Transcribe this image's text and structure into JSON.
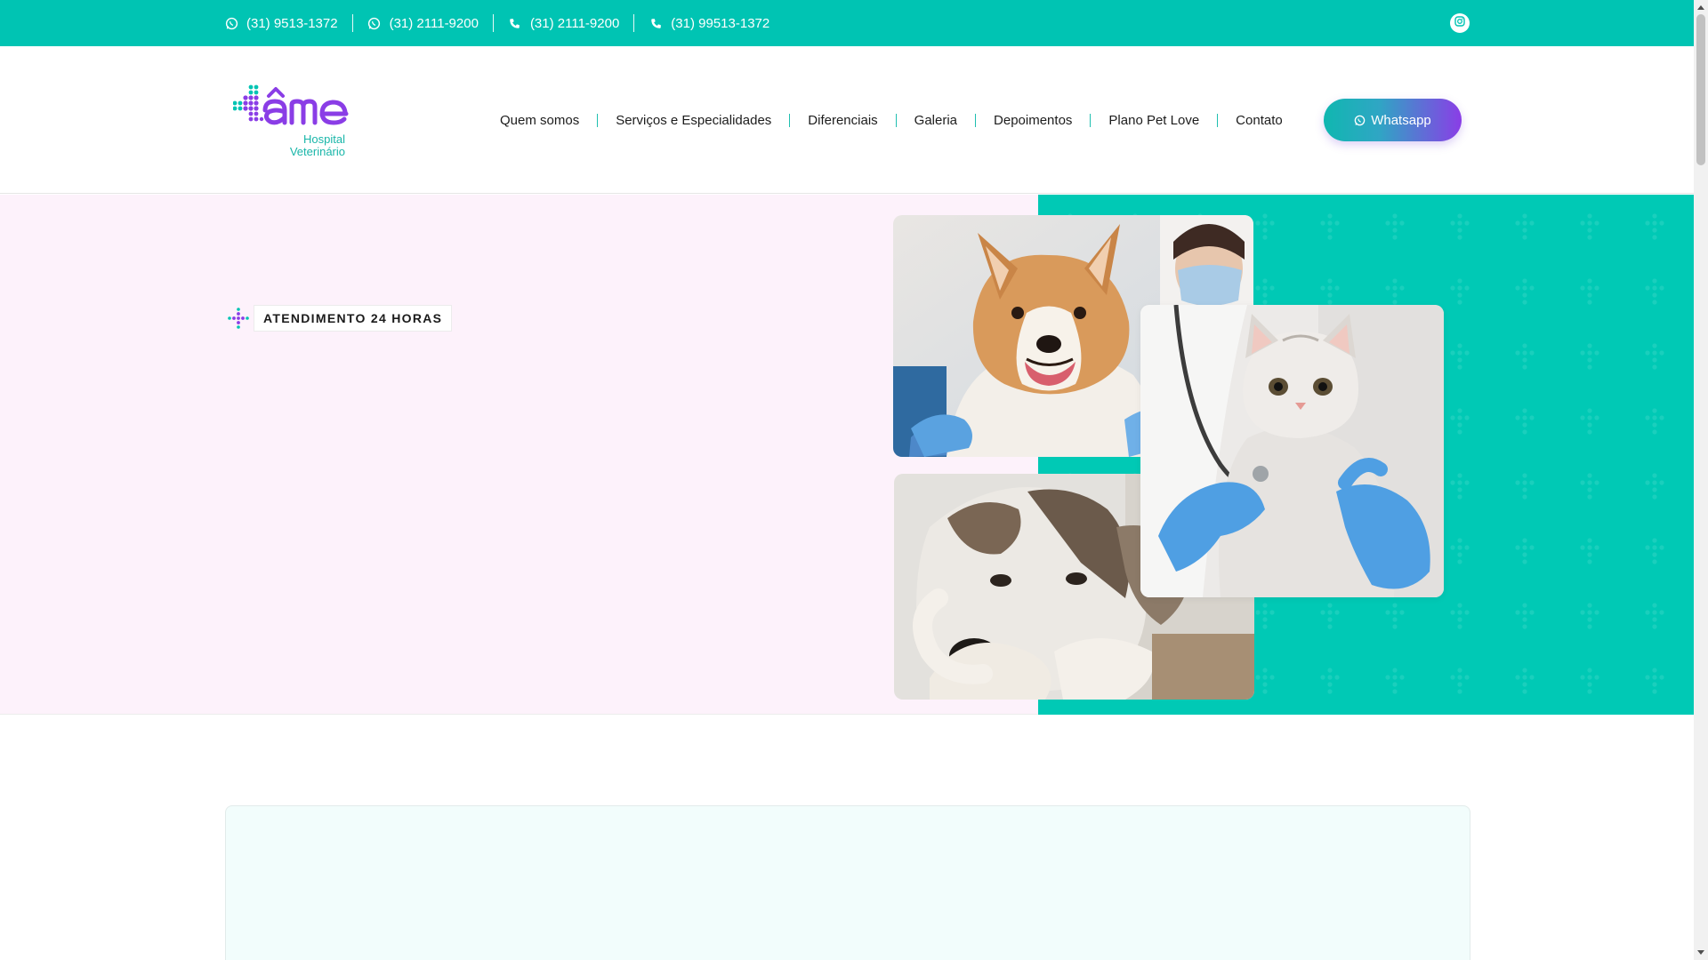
{
  "topbar": {
    "contacts": [
      {
        "icon": "whatsapp-icon",
        "text": "(31) 9513-1372"
      },
      {
        "icon": "whatsapp-icon",
        "text": "(31) 2111-9200"
      },
      {
        "icon": "phone-icon",
        "text": "(31) 2111-9200"
      },
      {
        "icon": "phone-icon",
        "text": "(31) 99513-1372"
      }
    ],
    "social_icon": "instagram-icon"
  },
  "header": {
    "logo_sub_line1": "Hospital",
    "logo_sub_line2": "Veterinário",
    "nav": [
      "Quem somos",
      "Serviços e Especialidades",
      "Diferenciais",
      "Galeria",
      "Depoimentos",
      "Plano Pet Love",
      "Contato"
    ],
    "cta_label": "Whatsapp"
  },
  "hero": {
    "badge_label": "ATENDIMENTO 24 HORAS"
  },
  "colors": {
    "brand_teal": "#00c4b3",
    "brand_purple": "#8a3de6",
    "hero_bg": "#fdf2fb"
  }
}
